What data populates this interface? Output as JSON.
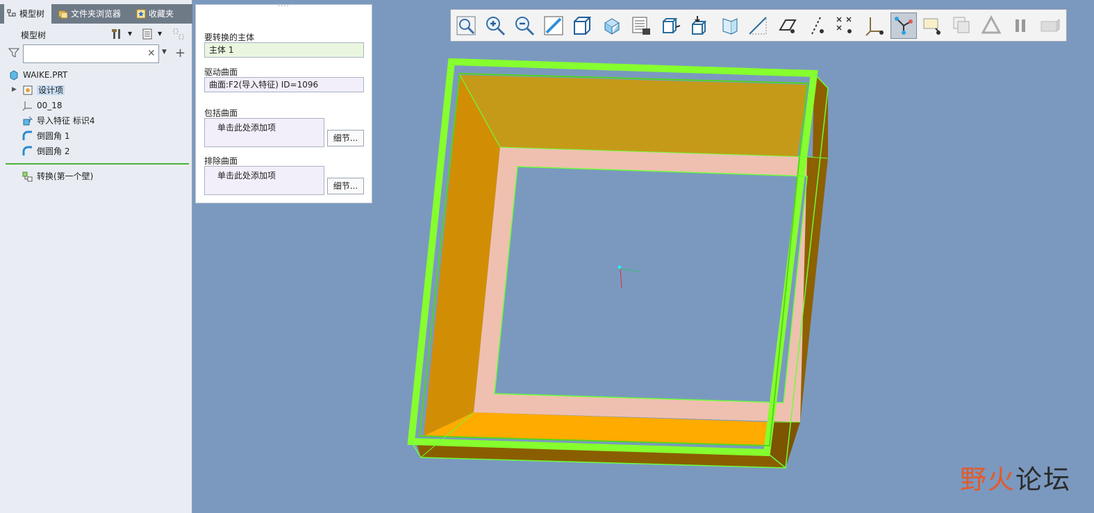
{
  "tabs": [
    {
      "label": "模型树",
      "icon": "model-tree-icon"
    },
    {
      "label": "文件夹浏览器",
      "icon": "folder-browser-icon"
    },
    {
      "label": "收藏夹",
      "icon": "favorites-icon"
    }
  ],
  "tree": {
    "title": "模型树",
    "search_value": "",
    "root": "WAIKE.PRT",
    "nodes": [
      {
        "label": "设计项",
        "icon": "design-items-icon"
      },
      {
        "label": "00_18",
        "icon": "coordinate-system-icon"
      },
      {
        "label": "导入特征 标识4",
        "icon": "import-feature-icon"
      },
      {
        "label": "倒圆角 1",
        "icon": "round-icon"
      },
      {
        "label": "倒圆角 2",
        "icon": "round-icon"
      }
    ],
    "insert_node": {
      "label": "转换(第一个壁)",
      "icon": "convert-icon"
    }
  },
  "panel": {
    "body_label": "要转换的主体",
    "body_value": "主体 1",
    "drive_label": "驱动曲面",
    "drive_value": "曲面:F2(导入特征)  ID=1096",
    "include_label": "包括曲面",
    "include_value": "单击此处添加项",
    "exclude_label": "排除曲面",
    "exclude_value": "单击此处添加项",
    "details_label": "细节..."
  },
  "toolbar": [
    "refit-icon",
    "zoom-in-icon",
    "zoom-out-icon",
    "repaint-icon",
    "display-style-icon",
    "saved-orientations-icon",
    "view-manager-icon",
    "perspective-view-icon",
    "annotation-display-icon",
    "spin-center-icon",
    "plane-display-icon",
    "axis-display-icon",
    "sketch-plane-icon",
    "axis-tag-icon",
    "point-display-icon",
    "csys-display-icon",
    "sheetmetal-icon",
    "view-filter-icon",
    "note-display-icon",
    "simplified-rep-icon",
    "pause-icon",
    "shell-icon"
  ],
  "watermark": {
    "first": "野火",
    "rest": "论坛"
  },
  "colors": {
    "viewport_bg": "#7b99bf",
    "highlight": "#86ff2e",
    "inner_wall": "#c8961a",
    "floor": "#efc0b0"
  }
}
